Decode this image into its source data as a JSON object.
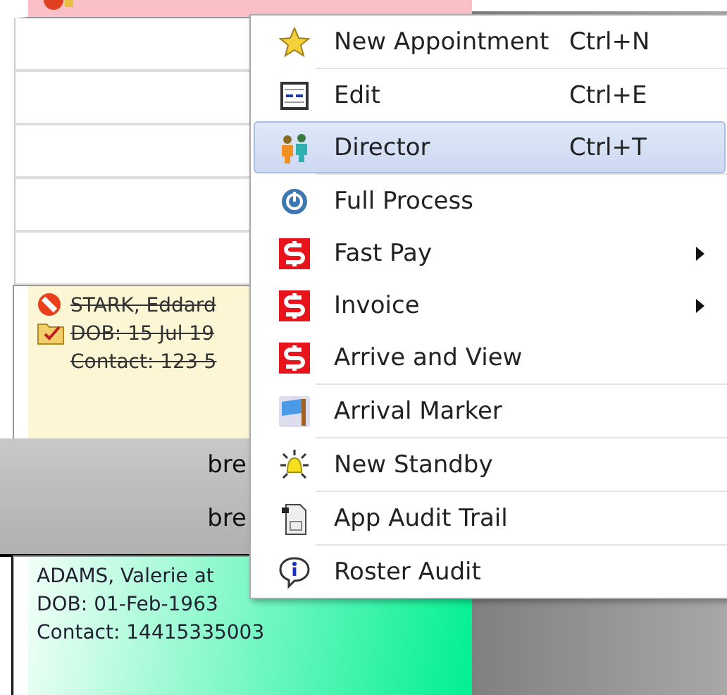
{
  "calendar": {
    "appointments": [
      {
        "kind": "cancelled",
        "lines": [
          "STARK, Eddard",
          "DOB: 15 Jul 19",
          "Contact: 123 5"
        ]
      }
    ],
    "breaks": [
      "bre",
      "bre"
    ],
    "current_appointment": {
      "kind": "active",
      "lines": [
        "ADAMS, Valerie at",
        "DOB: 01-Feb-1963",
        "Contact: 14415335003"
      ]
    }
  },
  "context_menu": {
    "items": [
      {
        "kind": "star",
        "label": "New Appointment",
        "shortcut": "Ctrl+N",
        "selected": false,
        "submenu": false,
        "separator_after": true
      },
      {
        "kind": "form",
        "label": "Edit",
        "shortcut": "Ctrl+E",
        "selected": false,
        "submenu": false,
        "separator_after": false
      },
      {
        "kind": "people",
        "label": "Director",
        "shortcut": "Ctrl+T",
        "selected": true,
        "submenu": false,
        "separator_after": true
      },
      {
        "kind": "power",
        "label": "Full Process",
        "selected": false,
        "submenu": false,
        "separator_after": false
      },
      {
        "kind": "dollar",
        "label": "Fast Pay",
        "selected": false,
        "submenu": true,
        "separator_after": false
      },
      {
        "kind": "dollar",
        "label": "Invoice",
        "selected": false,
        "submenu": true,
        "separator_after": false
      },
      {
        "kind": "dollar",
        "label": "Arrive and View",
        "selected": false,
        "submenu": false,
        "separator_after": true
      },
      {
        "kind": "flag",
        "label": "Arrival Marker",
        "selected": false,
        "submenu": false,
        "separator_after": true
      },
      {
        "kind": "bell",
        "label": "New Standby",
        "selected": false,
        "submenu": false,
        "separator_after": true
      },
      {
        "kind": "document",
        "label": "App Audit Trail",
        "selected": false,
        "submenu": false,
        "separator_after": true
      },
      {
        "kind": "info",
        "label": "Roster Audit",
        "selected": false,
        "submenu": false,
        "separator_after": false
      }
    ]
  }
}
